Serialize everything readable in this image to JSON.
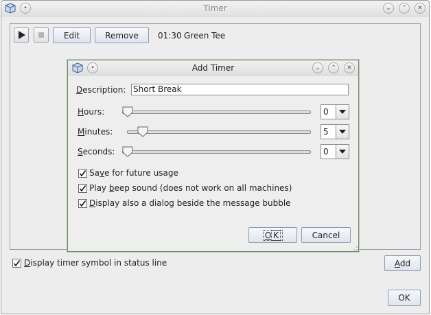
{
  "main_window": {
    "title": "Timer",
    "toolbar": {
      "edit_label": "Edit",
      "remove_label": "Remove",
      "timer_time": "01:30",
      "timer_name": "Green Tee"
    },
    "status_checkbox": {
      "mnemonic": "D",
      "rest": "isplay timer symbol in status line",
      "checked": true
    },
    "add_button": {
      "mnemonic": "A",
      "rest": "dd"
    },
    "ok_button": "OK"
  },
  "dialog": {
    "title": "Add Timer",
    "description": {
      "mnemonic": "D",
      "rest": "escription:",
      "value": "Short Break"
    },
    "hours": {
      "mnemonic": "H",
      "rest": "ours:",
      "value": "0",
      "slider_fraction": 0.0
    },
    "minutes": {
      "mnemonic": "M",
      "rest": "inutes:",
      "value": "5",
      "slider_fraction": 0.083
    },
    "seconds": {
      "mnemonic": "S",
      "rest": "econds:",
      "value": "0",
      "slider_fraction": 0.0
    },
    "options": [
      {
        "pre": "Sa",
        "mnemonic": "v",
        "rest": "e for future usage",
        "checked": true
      },
      {
        "pre": "Play ",
        "mnemonic": "b",
        "rest": "eep sound (does not work on all machines)",
        "checked": true
      },
      {
        "pre": "",
        "mnemonic": "D",
        "rest": "isplay also a dialog beside the message bubble",
        "checked": true
      }
    ],
    "ok_button": {
      "mnemonic": "O",
      "rest": "K"
    },
    "cancel_button": "Cancel"
  },
  "colors": {
    "window_bg": "#ededed",
    "dialog_border": "#6d8c66",
    "button_border": "#8b9bb0"
  }
}
